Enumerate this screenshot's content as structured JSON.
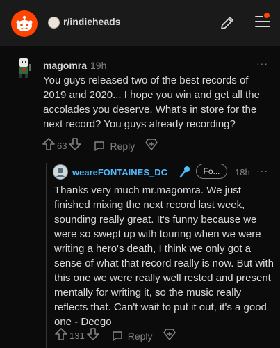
{
  "header": {
    "subreddit": "r/indieheads"
  },
  "comments": [
    {
      "username": "magomra",
      "time": "19h",
      "body": "You guys released two of the best records of 2019 and 2020... I hope you win and get all the accolades you deserve. What's in store for the next record? You guys already recording?",
      "score": "63",
      "reply_label": "Reply",
      "more": "···"
    },
    {
      "username": "weareFONTAINES_DC",
      "flair": "Fo...",
      "time": "18h",
      "body": "Thanks very much mr.magomra. We just finished mixing the next record last week, sounding really great. It's funny because we were so swept up with touring when we were writing a hero's death, I think we only got a sense of what that record really is now. But with this one we were really well rested and present mentally for writing it, so the music really reflects that. Can't wait to put it out, it's a good one - Deego",
      "score": "131",
      "reply_label": "Reply",
      "more": "···"
    }
  ],
  "colors": {
    "accent": "#ff4500",
    "op_username": "#4fbcff",
    "background": "#0b0b0b"
  },
  "icons": [
    "reddit-logo-icon",
    "edit-icon",
    "menu-icon",
    "upvote-icon",
    "downvote-icon",
    "reply-icon",
    "award-icon",
    "microphone-icon"
  ]
}
